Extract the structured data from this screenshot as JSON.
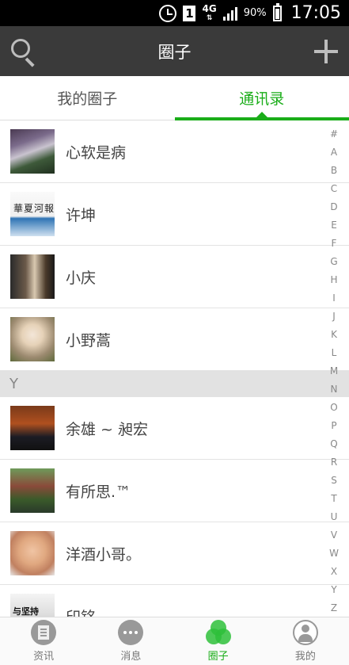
{
  "status_bar": {
    "sim": "1",
    "network": "4G",
    "battery": "90%",
    "time": "17:05",
    "icons": [
      "alarm-icon",
      "sim-icon",
      "network-icon",
      "signal-icon",
      "battery-icon"
    ]
  },
  "header": {
    "title": "圈子",
    "left_icon": "search-icon",
    "right_icon": "plus-icon"
  },
  "tabs": [
    {
      "label": "我的圈子",
      "active": false
    },
    {
      "label": "通讯录",
      "active": true
    }
  ],
  "contacts": [
    {
      "name": "心软是病"
    },
    {
      "name": "许坤",
      "avatar_text": "華夏河報"
    },
    {
      "name": "小庆"
    },
    {
      "name": "小野蒿"
    },
    {
      "section": "Y"
    },
    {
      "name": "余雄 ~ 昶宏"
    },
    {
      "name": "有所思.™"
    },
    {
      "name": "洋酒小哥。"
    },
    {
      "name": "印铭",
      "avatar_text": "与坚持"
    }
  ],
  "alpha_index": [
    "#",
    "A",
    "B",
    "C",
    "D",
    "E",
    "F",
    "G",
    "H",
    "I",
    "J",
    "K",
    "L",
    "M",
    "N",
    "O",
    "P",
    "Q",
    "R",
    "S",
    "T",
    "U",
    "V",
    "W",
    "X",
    "Y",
    "Z"
  ],
  "bottom_nav": [
    {
      "label": "资讯",
      "icon": "news-icon",
      "active": false
    },
    {
      "label": "消息",
      "icon": "message-icon",
      "active": false
    },
    {
      "label": "圈子",
      "icon": "circle-icon",
      "active": true
    },
    {
      "label": "我的",
      "icon": "profile-icon",
      "active": false
    }
  ],
  "colors": {
    "accent": "#1aad19",
    "title_bar": "#3a3a3a",
    "status_bar": "#000000",
    "section_bg": "#e2e2e2"
  }
}
